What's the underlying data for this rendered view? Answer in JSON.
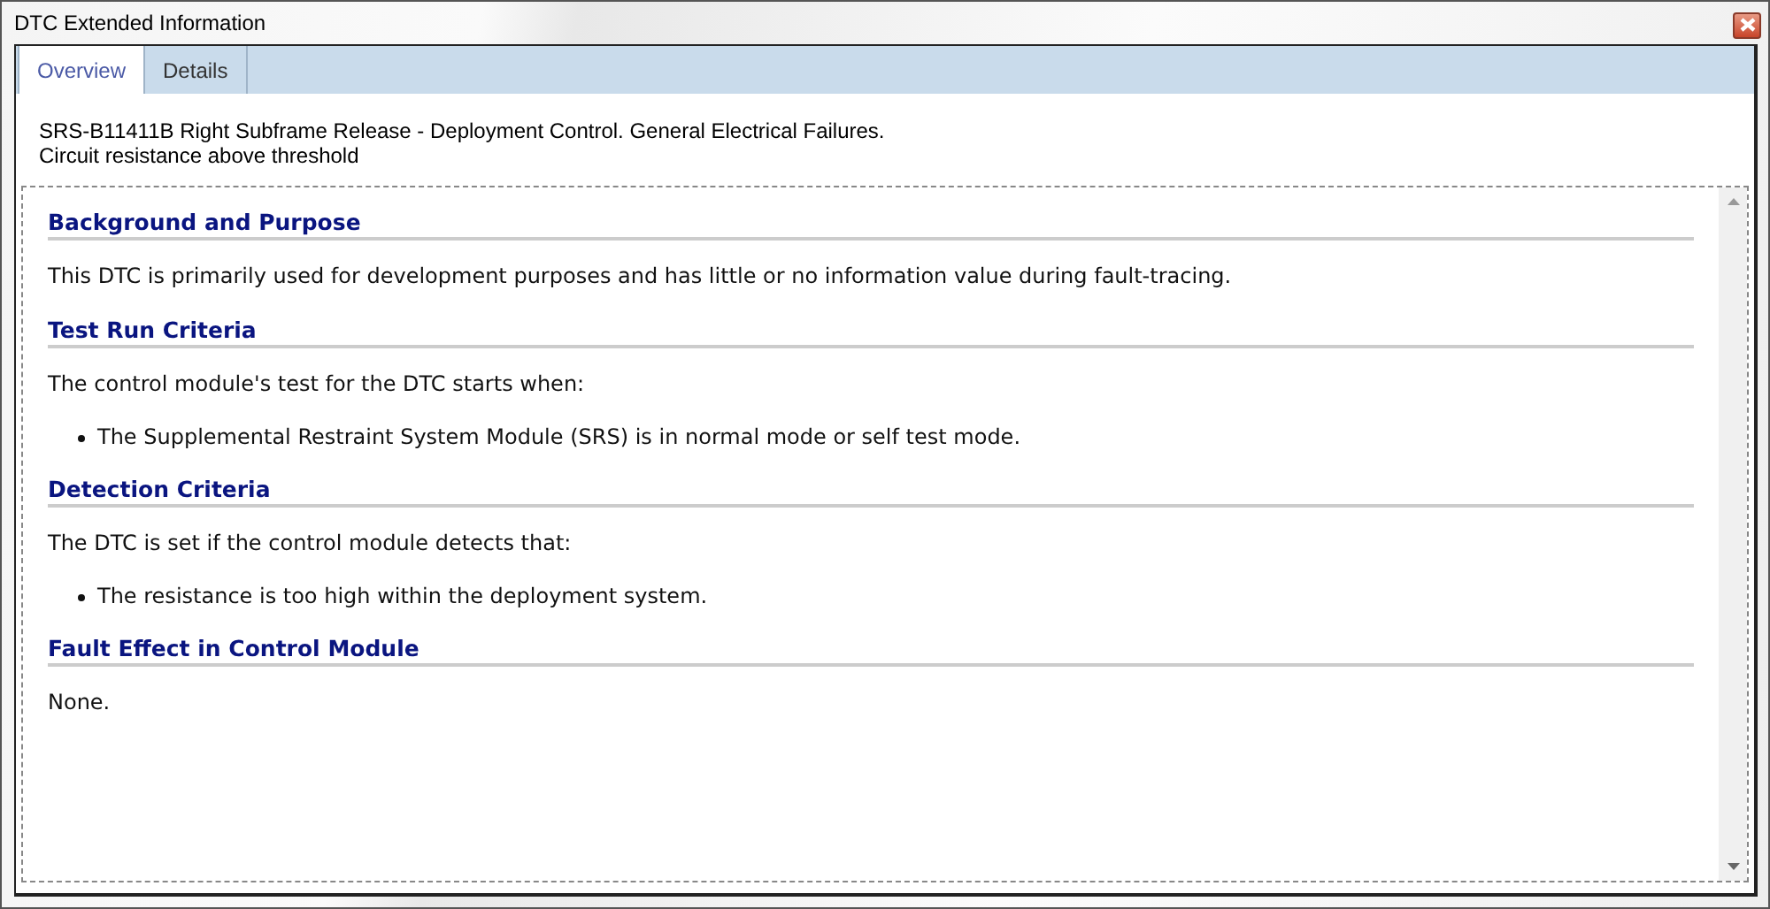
{
  "window": {
    "title": "DTC Extended Information"
  },
  "tabs": [
    {
      "label": "Overview",
      "selected": true
    },
    {
      "label": "Details",
      "selected": false
    }
  ],
  "summary": [
    "SRS-B11411B Right Subframe Release - Deployment Control. General Electrical Failures.",
    "Circuit resistance above threshold"
  ],
  "sections": [
    {
      "heading": "Background and Purpose",
      "blocks": [
        {
          "kind": "paragraph",
          "text": "This DTC is primarily used for development purposes and has little or no information value during fault-tracing."
        }
      ]
    },
    {
      "heading": "Test Run Criteria",
      "blocks": [
        {
          "kind": "paragraph",
          "text": "The control module's test for the DTC starts when:"
        },
        {
          "kind": "bullet",
          "text": "The Supplemental Restraint System Module (SRS) is in normal mode or self test mode."
        }
      ]
    },
    {
      "heading": "Detection Criteria",
      "blocks": [
        {
          "kind": "paragraph",
          "text": "The DTC is set if the control module detects that:"
        },
        {
          "kind": "bullet",
          "text": "The resistance is too high within the deployment system."
        }
      ]
    },
    {
      "heading": "Fault Effect in Control Module",
      "blocks": [
        {
          "kind": "paragraph",
          "text": "None."
        }
      ]
    }
  ]
}
